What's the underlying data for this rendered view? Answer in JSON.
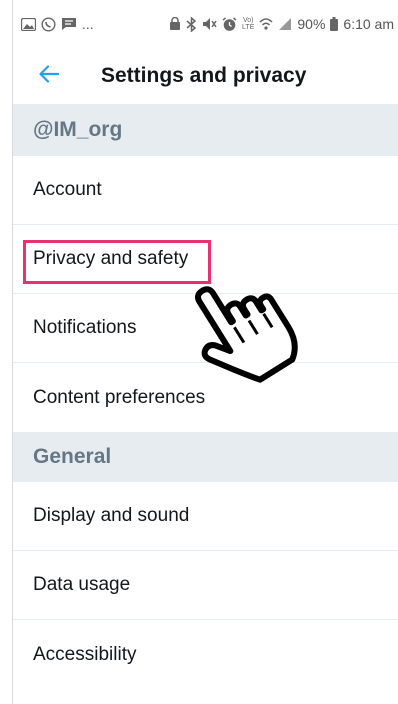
{
  "status_bar": {
    "notification_dots": "...",
    "lte_label": "LTE",
    "battery": "90%",
    "time": "6:10 am"
  },
  "header": {
    "title": "Settings and privacy"
  },
  "sections": [
    {
      "title": "@IM_org",
      "items": [
        {
          "label": "Account"
        },
        {
          "label": "Privacy and safety"
        },
        {
          "label": "Notifications"
        },
        {
          "label": "Content preferences"
        }
      ]
    },
    {
      "title": "General",
      "items": [
        {
          "label": "Display and sound"
        },
        {
          "label": "Data usage"
        },
        {
          "label": "Accessibility"
        }
      ]
    }
  ],
  "colors": {
    "accent": "#1da1f2",
    "highlight": "#e5316e",
    "section_bg": "#e6ecf0",
    "section_text": "#657786",
    "text": "#14171a"
  }
}
